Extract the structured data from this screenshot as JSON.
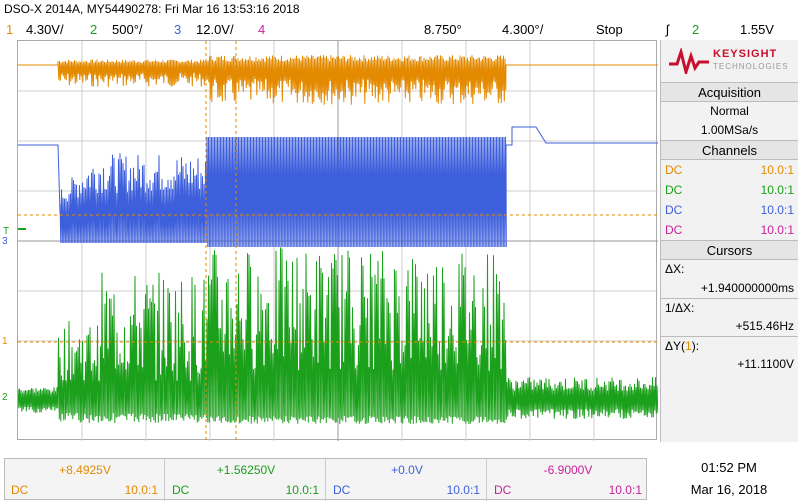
{
  "header": {
    "title": "DSO-X 2014A, MY54490278: Fri Mar 16 13:53:16 2018",
    "ch1_num": "1",
    "ch1_scale": "4.30V/",
    "ch2_num": "2",
    "ch2_scale": "500°/",
    "ch3_num": "3",
    "ch3_scale": "12.0V/",
    "ch4_num": "4",
    "timebase_pos": "8.750°",
    "timebase_scale": "4.300°/",
    "run_state": "Stop",
    "trig_symbol": "ʃ",
    "trig_ch": "2",
    "trig_level": "1.55V"
  },
  "markers": {
    "ch3": "3",
    "ch1": "1",
    "ch2": "2",
    "trig": "T"
  },
  "panel": {
    "brand": "KEYSIGHT",
    "brand_sub": "TECHNOLOGIES",
    "acq_title": "Acquisition",
    "acq_mode": "Normal",
    "acq_rate": "1.00MSa/s",
    "channels_title": "Channels",
    "channels": [
      {
        "coupling": "DC",
        "probe": "10.0:1",
        "color": "#e38a00"
      },
      {
        "coupling": "DC",
        "probe": "10.0:1",
        "color": "#1ba01b"
      },
      {
        "coupling": "DC",
        "probe": "10.0:1",
        "color": "#3e5fdc"
      },
      {
        "coupling": "DC",
        "probe": "10.0:1",
        "color": "#c8229a"
      }
    ],
    "cursors_title": "Cursors",
    "dx_label": "ΔX:",
    "dx_value": "+1.940000000ms",
    "inv_dx_label": "1/ΔX:",
    "inv_dx_value": "+515.46Hz",
    "dy_label": "ΔY(",
    "dy_ch": "1",
    "dy_label_end": "):",
    "dy_value": "+11.1100V"
  },
  "bottom": {
    "channels": [
      {
        "value": "+8.4925V",
        "coupling": "DC",
        "probe": "10.0:1",
        "color": "#e38a00"
      },
      {
        "value": "+1.56250V",
        "coupling": "DC",
        "probe": "10.0:1",
        "color": "#1ba01b"
      },
      {
        "value": "+0.0V",
        "coupling": "DC",
        "probe": "10.0:1",
        "color": "#3e5fdc"
      },
      {
        "value": "-6.9000V",
        "coupling": "DC",
        "probe": "10.0:1",
        "color": "#c8229a"
      }
    ],
    "time": "01:52 PM",
    "date": "Mar 16, 2018"
  },
  "colors": {
    "ch1": "#e38a00",
    "ch2": "#1ba01b",
    "ch3": "#3e5fdc",
    "ch4": "#c8229a"
  }
}
